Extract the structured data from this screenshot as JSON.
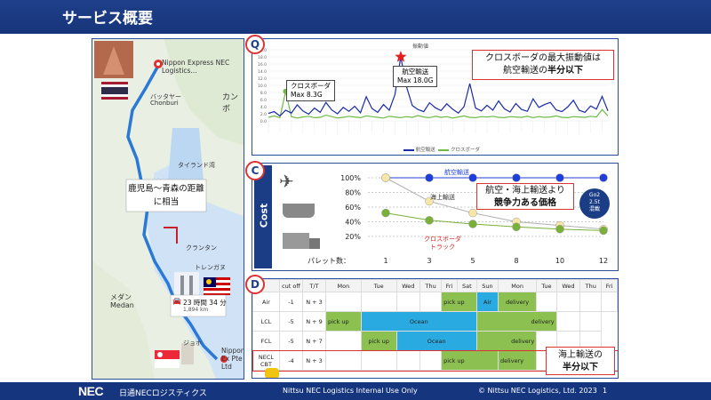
{
  "header": {
    "title": "サービス概要"
  },
  "map": {
    "origin_label": "Nippon Express NEC Logistics...",
    "destination_label": "Nippon Ex Pte Ltd",
    "place_labels": [
      "バッタヤー",
      "Chonburi",
      "カンボ",
      "タイランド湾",
      "クランタン",
      "トレンガヌ",
      "メダン",
      "Medan",
      "ジョホ"
    ],
    "route_time": "23 時間 34 分",
    "route_distance": "1,894 km",
    "distance_note": "鹿児島～青森の距離に相当"
  },
  "panel_q": {
    "badge": "Q",
    "chart_title": "振動値",
    "callout": {
      "line1": "クロスボーダの最大振動値は",
      "line2_prefix": "航空輸送の",
      "line2_emph": "半分以下"
    },
    "label_cbt": "クロスボーダ",
    "label_cbt_max": "Max 8.3G",
    "label_air": "航空輸送",
    "label_air_max": "Max 18.0G",
    "legend": [
      "航空輸送",
      "クロスボーダ"
    ]
  },
  "panel_c": {
    "badge": "C",
    "side_label": "Cost",
    "callout": {
      "line1": "航空・海上輸送より",
      "line2": "競争力ある価格"
    },
    "go2": {
      "line1": "Go2",
      "line2": "2.5t",
      "line3": "混載"
    },
    "xlabel": "パレット数："
  },
  "panel_d": {
    "badge": "D",
    "headers": [
      "cut off",
      "T/T",
      "Mon",
      "Tue",
      "Wed",
      "Thu",
      "Fri",
      "Sat",
      "Sun",
      "Mon",
      "Tue",
      "Wed",
      "Thu",
      "Fri"
    ],
    "rows": [
      {
        "mode": "Air",
        "cutoff": "-1",
        "tt": "N + 3",
        "bars": [
          {
            "label": "pick up"
          },
          {
            "label": "Air"
          },
          {
            "label": "delivery"
          }
        ]
      },
      {
        "mode": "LCL",
        "cutoff": "-5",
        "tt": "N + 9",
        "bars": [
          {
            "label": "pick up"
          },
          {
            "label": "Ocean"
          },
          {
            "label": "delivery"
          }
        ]
      },
      {
        "mode": "FCL",
        "cutoff": "-5",
        "tt": "N + 7",
        "bars": [
          {
            "label": "pick up"
          },
          {
            "label": "Ocean"
          },
          {
            "label": "delivery"
          }
        ]
      },
      {
        "mode": "NECL CBT",
        "cutoff": "-4",
        "tt": "N + 3",
        "bars": [
          {
            "label": "pick up"
          },
          {
            "label": "delivery"
          }
        ]
      }
    ],
    "callout": {
      "line1": "海上輸送の",
      "line2": "半分以下"
    }
  },
  "chart_data": [
    {
      "type": "line",
      "title": "振動値",
      "ylim": [
        0,
        20
      ],
      "y_ticks": [
        "0.0",
        "2.0",
        "4.0",
        "6.0",
        "8.0",
        "10.0",
        "12.0",
        "14.0",
        "16.0",
        "18.0",
        "20.0"
      ],
      "series": [
        {
          "name": "航空輸送",
          "color": "#1a2aa8",
          "values": [
            2.1,
            2.6,
            1.4,
            3.0,
            2.2,
            4.5,
            2.8,
            1.9,
            3.6,
            2.4,
            5.2,
            3.1,
            2.0,
            3.8,
            2.7,
            4.1,
            2.3,
            6.8,
            3.5,
            2.4,
            4.6,
            3.0,
            7.4,
            18.0,
            9.6,
            4.3,
            3.2,
            2.6,
            5.1,
            3.7,
            2.9,
            4.8,
            3.3,
            2.2,
            4.0,
            10.5,
            3.6,
            2.8,
            4.4,
            3.0,
            5.6,
            3.4,
            2.5,
            4.9,
            3.2,
            2.7,
            6.2,
            3.8,
            4.6,
            5.2,
            3.1,
            2.6,
            3.9,
            5.8,
            3.0,
            2.4,
            4.2,
            3.3,
            6.9,
            2.8
          ]
        },
        {
          "name": "クロスボーダ",
          "color": "#6fba45",
          "values": [
            1.0,
            1.4,
            0.9,
            8.3,
            1.2,
            0.8,
            1.1,
            1.3,
            0.9,
            1.0,
            1.6,
            1.2,
            0.8,
            1.0,
            1.3,
            1.1,
            0.9,
            1.4,
            1.2,
            1.0,
            0.8,
            1.3,
            1.1,
            0.9,
            1.2,
            1.0,
            1.5,
            1.1,
            0.9,
            1.3,
            1.0,
            1.2,
            0.8,
            1.1,
            1.4,
            1.0,
            0.9,
            1.2,
            1.1,
            1.3,
            1.0,
            0.9,
            1.2,
            1.1,
            1.0,
            1.3,
            0.9,
            1.2,
            1.0,
            1.1,
            1.4,
            1.0,
            0.9,
            1.2,
            1.1,
            1.0,
            1.3,
            1.1,
            3.2,
            1.4
          ]
        }
      ]
    },
    {
      "type": "line",
      "categories": [
        "1",
        "3",
        "5",
        "8",
        "10",
        "12"
      ],
      "ylim": [
        0,
        100
      ],
      "y_ticks": [
        "20%",
        "30%",
        "40%",
        "50%",
        "60%",
        "70%",
        "80%",
        "90%",
        "100%"
      ],
      "series": [
        {
          "name": "航空輸送",
          "color": "#1f3fd8",
          "values": [
            100,
            100,
            100,
            100,
            100,
            100
          ]
        },
        {
          "name": "海上輸送",
          "color": "#b0b0b0",
          "values": [
            100,
            68,
            52,
            40,
            35,
            30
          ]
        },
        {
          "name": "クロスボーダ トラック",
          "color": "#79b03a",
          "values": [
            52,
            42,
            37,
            33,
            30,
            28
          ]
        }
      ],
      "series_labels": {
        "air": "航空輸送",
        "sea": "海上輸送",
        "cbt_1": "クロスボーダ",
        "cbt_2": "トラック"
      }
    }
  ],
  "footer": {
    "logo": "NEC",
    "company": "日通NECロジスティクス",
    "internal": "Nittsu NEC Logistics Internal Use Only",
    "copyright": "© Nittsu NEC Logistics, Ltd. 2023",
    "page": "1"
  }
}
